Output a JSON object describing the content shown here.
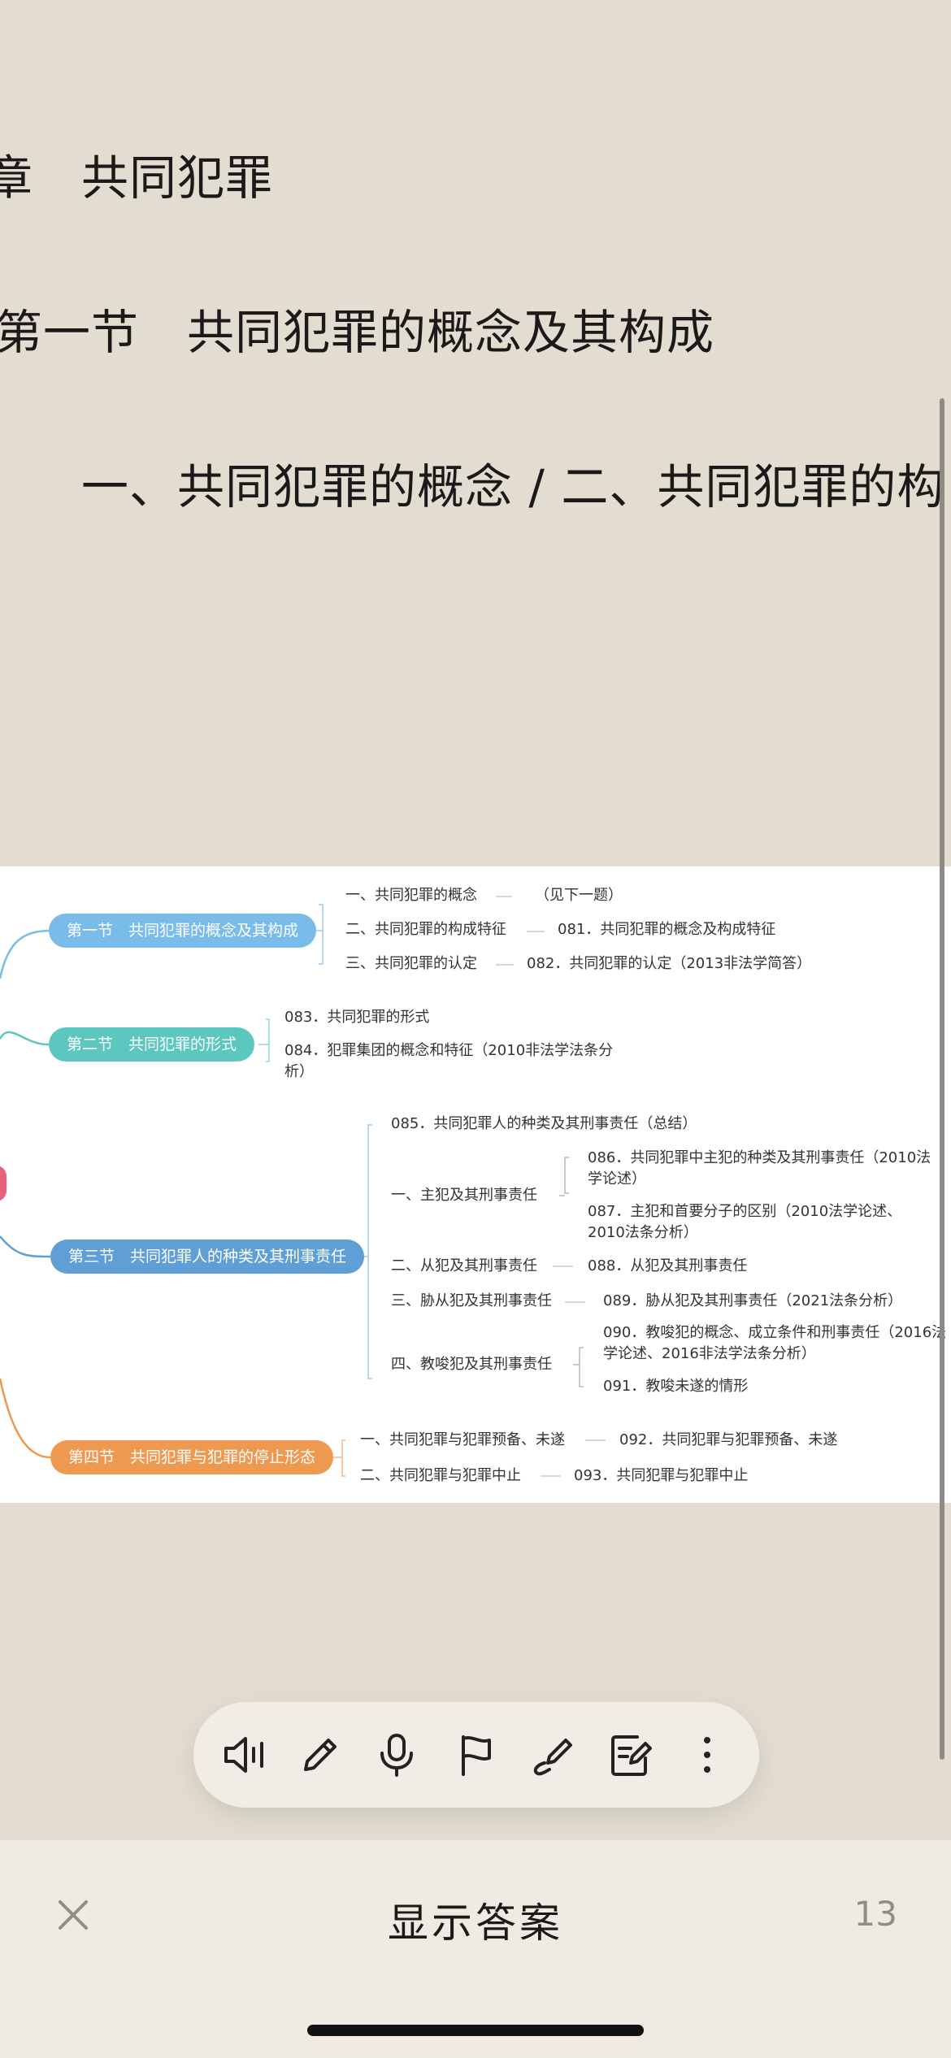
{
  "content": {
    "chapter_title": "章　共同犯罪",
    "section_title": "第一节　共同犯罪的概念及其构成",
    "subsection_title": "一、共同犯罪的概念 / 二、共同犯罪的构"
  },
  "mindmap": {
    "sections": [
      {
        "label": "第一节　共同犯罪的概念及其构成",
        "color": "#79bcea"
      },
      {
        "label": "第二节　共同犯罪的形式",
        "color": "#5cc7bf"
      },
      {
        "label": "第三节　共同犯罪人的种类及其刑事责任",
        "color": "#5f9fd5"
      },
      {
        "label": "第四节　共同犯罪与犯罪的停止形态",
        "color": "#ee9950"
      }
    ],
    "s1": {
      "a": "一、共同犯罪的概念",
      "a_note": "（见下一题）",
      "b": "二、共同犯罪的构成特征",
      "b_note": "081．共同犯罪的概念及构成特征",
      "c": "三、共同犯罪的认定",
      "c_note": "082．共同犯罪的认定（2013非法学简答）"
    },
    "s2": {
      "a": "083．共同犯罪的形式",
      "b": "084．犯罪集团的概念和特征（2010非法学法条分析）"
    },
    "s3": {
      "top": "085．共同犯罪人的种类及其刑事责任（总结）",
      "main": "一、主犯及其刑事责任",
      "main_a": "086．共同犯罪中主犯的种类及其刑事责任（2010法学论述）",
      "main_b": "087．主犯和首要分子的区别（2010法学论述、2010法条分析）",
      "accessory": "二、从犯及其刑事责任",
      "accessory_note": "088．从犯及其刑事责任",
      "coerced": "三、胁从犯及其刑事责任",
      "coerced_note": "089．胁从犯及其刑事责任（2021法条分析）",
      "instigator": "四、教唆犯及其刑事责任",
      "instigator_a": "090．教唆犯的概念、成立条件和刑事责任（2016法学论述、2016非法学法条分析）",
      "instigator_b": "091．教唆未遂的情形"
    },
    "s4": {
      "a": "一、共同犯罪与犯罪预备、未遂",
      "a_note": "092．共同犯罪与犯罪预备、未遂",
      "b": "二、共同犯罪与犯罪中止",
      "b_note": "093．共同犯罪与犯罪中止"
    }
  },
  "toolbar": {
    "buttons": [
      {
        "name": "speaker-icon",
        "label": "朗读"
      },
      {
        "name": "pencil-icon",
        "label": "编辑"
      },
      {
        "name": "microphone-icon",
        "label": "录音"
      },
      {
        "name": "flag-icon",
        "label": "标记"
      },
      {
        "name": "pen-icon",
        "label": "手写"
      },
      {
        "name": "note-icon",
        "label": "笔记"
      },
      {
        "name": "more-icon",
        "label": "更多"
      }
    ]
  },
  "bottom_bar": {
    "show_answer_label": "显示答案",
    "page_count": "13"
  }
}
